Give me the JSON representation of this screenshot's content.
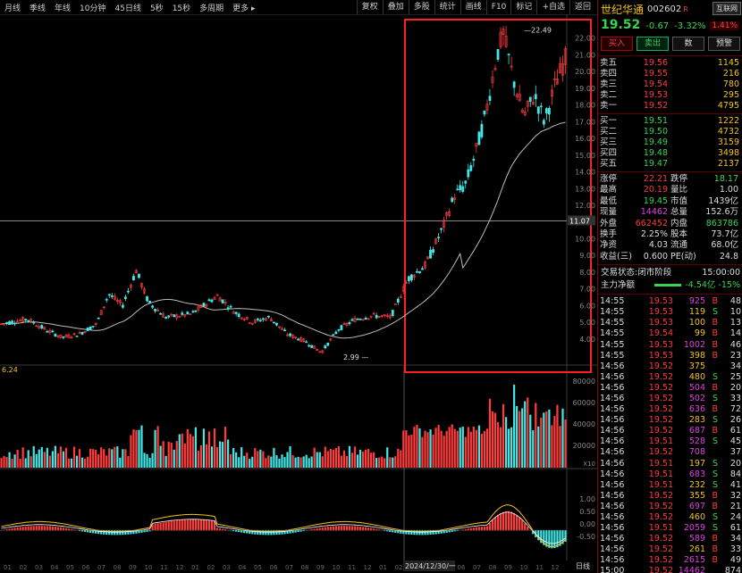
{
  "toolbar": {
    "periods": [
      "月线",
      "季线",
      "年线",
      "10分钟",
      "45日线",
      "5秒",
      "15秒",
      "多周期",
      "更多 ▸"
    ],
    "right_buttons": [
      "复权",
      "叠加",
      "多股",
      "统计",
      "画线",
      "F10",
      "标记",
      "+自选",
      "返回"
    ]
  },
  "stock": {
    "name": "世纪华通",
    "code": "002602",
    "marker": "R",
    "tag": "互联网",
    "tag_pct": "1.41%",
    "price": "19.52",
    "change": "-0.67",
    "change_pct": "-3.32%"
  },
  "trade_buttons": [
    "买入",
    "卖出",
    "数",
    "预警"
  ],
  "order_book": {
    "asks": [
      {
        "label": "卖五",
        "price": "19.56",
        "vol": "1145"
      },
      {
        "label": "卖四",
        "price": "19.55",
        "vol": "216"
      },
      {
        "label": "卖三",
        "price": "19.54",
        "vol": "780"
      },
      {
        "label": "卖二",
        "price": "19.53",
        "vol": "295"
      },
      {
        "label": "卖一",
        "price": "19.52",
        "vol": "4795"
      }
    ],
    "bids": [
      {
        "label": "买一",
        "price": "19.51",
        "vol": "1222"
      },
      {
        "label": "买二",
        "price": "19.50",
        "vol": "4732"
      },
      {
        "label": "买三",
        "price": "19.49",
        "vol": "3159"
      },
      {
        "label": "买四",
        "price": "19.48",
        "vol": "3498"
      },
      {
        "label": "买五",
        "price": "19.47",
        "vol": "2137"
      }
    ]
  },
  "stats": [
    [
      {
        "k": "涨停",
        "v": "22.21",
        "c": "red"
      },
      {
        "k": "跌停",
        "v": "18.17",
        "c": "green"
      }
    ],
    [
      {
        "k": "最高",
        "v": "20.19",
        "c": "red"
      },
      {
        "k": "量比",
        "v": "1.00",
        "c": "white"
      }
    ],
    [
      {
        "k": "最低",
        "v": "19.45",
        "c": "green"
      },
      {
        "k": "市值",
        "v": "1439亿",
        "c": "white"
      }
    ],
    [
      {
        "k": "现量",
        "v": "14462",
        "c": "magenta"
      },
      {
        "k": "总量",
        "v": "152.6万",
        "c": "white"
      }
    ],
    [
      {
        "k": "外盘",
        "v": "662452",
        "c": "red"
      },
      {
        "k": "内盘",
        "v": "863786",
        "c": "green"
      }
    ],
    [
      {
        "k": "换手",
        "v": "2.25%",
        "c": "white"
      },
      {
        "k": "股本",
        "v": "73.7亿",
        "c": "white"
      }
    ],
    [
      {
        "k": "净资",
        "v": "4.03",
        "c": "white"
      },
      {
        "k": "流通",
        "v": "68.0亿",
        "c": "white"
      }
    ],
    [
      {
        "k": "收益(三)",
        "v": "0.600",
        "c": "white"
      },
      {
        "k": "PE(动)",
        "v": "24.8",
        "c": "white"
      }
    ]
  ],
  "trade_status": {
    "label": "交易状态:",
    "value": "闭市阶段",
    "time": "15:00:00"
  },
  "main_net": {
    "label": "主力净额",
    "value": "-4.54亿",
    "pct": "-15%"
  },
  "trades": [
    {
      "t": "14:55",
      "p": "19.53",
      "v": "925",
      "d": "B",
      "n": "48",
      "pc": "red",
      "vc": "magenta"
    },
    {
      "t": "14:55",
      "p": "19.53",
      "v": "119",
      "d": "S",
      "n": "10",
      "pc": "red",
      "vc": "yellow"
    },
    {
      "t": "14:55",
      "p": "19.53",
      "v": "100",
      "d": "B",
      "n": "13",
      "pc": "red",
      "vc": "yellow"
    },
    {
      "t": "14:55",
      "p": "19.54",
      "v": "99",
      "d": "B",
      "n": "14",
      "pc": "red",
      "vc": "yellow"
    },
    {
      "t": "14:55",
      "p": "19.53",
      "v": "1002",
      "d": "B",
      "n": "46",
      "pc": "red",
      "vc": "magenta"
    },
    {
      "t": "14:55",
      "p": "19.53",
      "v": "398",
      "d": "B",
      "n": "23",
      "pc": "red",
      "vc": "yellow"
    },
    {
      "t": "14:56",
      "p": "19.52",
      "v": "375",
      "d": "",
      "n": "34",
      "pc": "red",
      "vc": "yellow"
    },
    {
      "t": "14:56",
      "p": "19.52",
      "v": "480",
      "d": "S",
      "n": "25",
      "pc": "red",
      "vc": "yellow"
    },
    {
      "t": "14:56",
      "p": "19.52",
      "v": "504",
      "d": "B",
      "n": "20",
      "pc": "red",
      "vc": "magenta"
    },
    {
      "t": "14:56",
      "p": "19.52",
      "v": "502",
      "d": "S",
      "n": "33",
      "pc": "red",
      "vc": "magenta"
    },
    {
      "t": "14:56",
      "p": "19.52",
      "v": "636",
      "d": "B",
      "n": "72",
      "pc": "red",
      "vc": "magenta"
    },
    {
      "t": "14:56",
      "p": "19.52",
      "v": "283",
      "d": "S",
      "n": "26",
      "pc": "red",
      "vc": "yellow"
    },
    {
      "t": "14:56",
      "p": "19.52",
      "v": "687",
      "d": "B",
      "n": "61",
      "pc": "red",
      "vc": "magenta"
    },
    {
      "t": "14:56",
      "p": "19.51",
      "v": "528",
      "d": "S",
      "n": "45",
      "pc": "red",
      "vc": "magenta"
    },
    {
      "t": "14:56",
      "p": "19.52",
      "v": "708",
      "d": "",
      "n": "37",
      "pc": "red",
      "vc": "magenta"
    },
    {
      "t": "14:56",
      "p": "19.51",
      "v": "197",
      "d": "S",
      "n": "20",
      "pc": "red",
      "vc": "yellow"
    },
    {
      "t": "14:56",
      "p": "19.51",
      "v": "683",
      "d": "S",
      "n": "84",
      "pc": "red",
      "vc": "magenta"
    },
    {
      "t": "14:56",
      "p": "19.51",
      "v": "232",
      "d": "S",
      "n": "41",
      "pc": "red",
      "vc": "yellow"
    },
    {
      "t": "14:56",
      "p": "19.52",
      "v": "355",
      "d": "B",
      "n": "32",
      "pc": "red",
      "vc": "yellow"
    },
    {
      "t": "14:56",
      "p": "19.52",
      "v": "697",
      "d": "B",
      "n": "21",
      "pc": "red",
      "vc": "magenta"
    },
    {
      "t": "14:56",
      "p": "19.52",
      "v": "460",
      "d": "S",
      "n": "24",
      "pc": "red",
      "vc": "yellow"
    },
    {
      "t": "14:56",
      "p": "19.51",
      "v": "2059",
      "d": "S",
      "n": "61",
      "pc": "red",
      "vc": "magenta"
    },
    {
      "t": "14:56",
      "p": "19.52",
      "v": "589",
      "d": "B",
      "n": "34",
      "pc": "red",
      "vc": "magenta"
    },
    {
      "t": "14:56",
      "p": "19.52",
      "v": "261",
      "d": "B",
      "n": "33",
      "pc": "red",
      "vc": "yellow"
    },
    {
      "t": "14:56",
      "p": "19.52",
      "v": "2615",
      "d": "B",
      "n": "49",
      "pc": "red",
      "vc": "magenta"
    },
    {
      "t": "15:00",
      "p": "19.52",
      "v": "14462",
      "d": "",
      "n": "874",
      "pc": "red",
      "vc": "magenta"
    }
  ],
  "chart": {
    "yticks": [
      "22.00",
      "21.00",
      "20.00",
      "19.00",
      "18.00",
      "17.00",
      "16.00",
      "15.00",
      "14.00",
      "13.00",
      "12.00",
      "11.00",
      "10.00",
      "9.00",
      "8.00",
      "7.00",
      "6.00",
      "5.00",
      "4.00"
    ],
    "crosshair_label": "11.07",
    "high_label": "22.49",
    "low_label": "2.99",
    "vol_label": "6.24",
    "vol_ticks": [
      "80000",
      "60000",
      "40000",
      "20000"
    ],
    "vol_unit": "X10",
    "macd_ticks": [
      "1.00",
      "0.50",
      "0.00",
      "-0.50"
    ],
    "date_label": "2024/12/30/一",
    "period_label": "日线",
    "x_labels": [
      "01",
      "02",
      "03",
      "04",
      "05",
      "06",
      "07",
      "08",
      "09",
      "10",
      "11",
      "12",
      "01",
      "02",
      "03",
      "04",
      "05",
      "06",
      "07",
      "08",
      "09",
      "10",
      "11",
      "12",
      "01",
      "02",
      "03",
      "04",
      "05",
      "06",
      "07",
      "08",
      "09",
      "10",
      "11",
      "12"
    ]
  },
  "colors": {
    "up": "#ff3b3b",
    "down": "#44e6e6",
    "ma": "#bdbdbd",
    "macd_dif": "#f2c21b",
    "macd_dea": "#ffffff",
    "highlight": "#ff2020"
  }
}
